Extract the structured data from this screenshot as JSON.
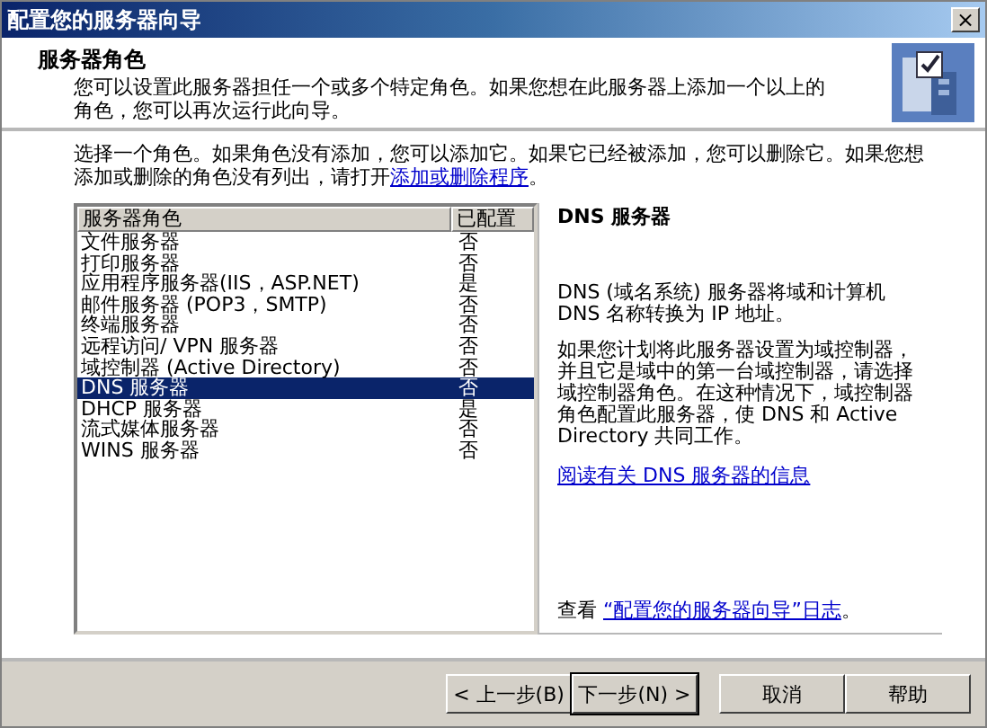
{
  "window": {
    "title": "配置您的服务器向导",
    "close": "×"
  },
  "header": {
    "title": "服务器角色",
    "description": "您可以设置此服务器担任一个或多个特定角色。如果您想在此服务器上添加一个以上的角色，您可以再次运行此向导。"
  },
  "intro": {
    "text": "选择一个角色。如果角色没有添加，您可以添加它。如果它已经被添加，您可以删除它。如果您想添加或删除的角色没有列出，请打开",
    "link": "添加或删除程序",
    "after": "。"
  },
  "table": {
    "columns": [
      "服务器角色",
      "已配置"
    ],
    "rows": [
      {
        "role": "文件服务器",
        "configured": "否",
        "selected": false
      },
      {
        "role": "打印服务器",
        "configured": "否",
        "selected": false
      },
      {
        "role": "应用程序服务器(IIS，ASP.NET)",
        "configured": "是",
        "selected": false
      },
      {
        "role": "邮件服务器 (POP3，SMTP)",
        "configured": "否",
        "selected": false
      },
      {
        "role": "终端服务器",
        "configured": "否",
        "selected": false
      },
      {
        "role": "远程访问/ VPN 服务器",
        "configured": "否",
        "selected": false
      },
      {
        "role": "域控制器 (Active Directory)",
        "configured": "否",
        "selected": false
      },
      {
        "role": "DNS 服务器",
        "configured": "否",
        "selected": true
      },
      {
        "role": "DHCP 服务器",
        "configured": "是",
        "selected": false
      },
      {
        "role": "流式媒体服务器",
        "configured": "否",
        "selected": false
      },
      {
        "role": "WINS 服务器",
        "configured": "否",
        "selected": false
      }
    ]
  },
  "details": {
    "title": "DNS 服务器",
    "paragraphs": [
      "DNS (域名系统) 服务器将域和计算机 DNS 名称转换为 IP 地址。",
      "如果您计划将此服务器设置为域控制器，并且它是域中的第一台域控制器，请选择域控制器角色。在这种情况下，域控制器角色配置此服务器，使 DNS 和 Active Directory 共同工作。"
    ],
    "info_link": "阅读有关 DNS 服务器的信息",
    "log": {
      "text": "查看",
      "link": "“配置您的服务器向导”日志",
      "after": "。"
    }
  },
  "buttons": [
    {
      "label": "< 上一步(B)",
      "default": false
    },
    {
      "label": "下一步(N) >",
      "default": true
    },
    {
      "label": "取消",
      "default": false
    },
    {
      "label": "帮助",
      "default": false
    }
  ]
}
